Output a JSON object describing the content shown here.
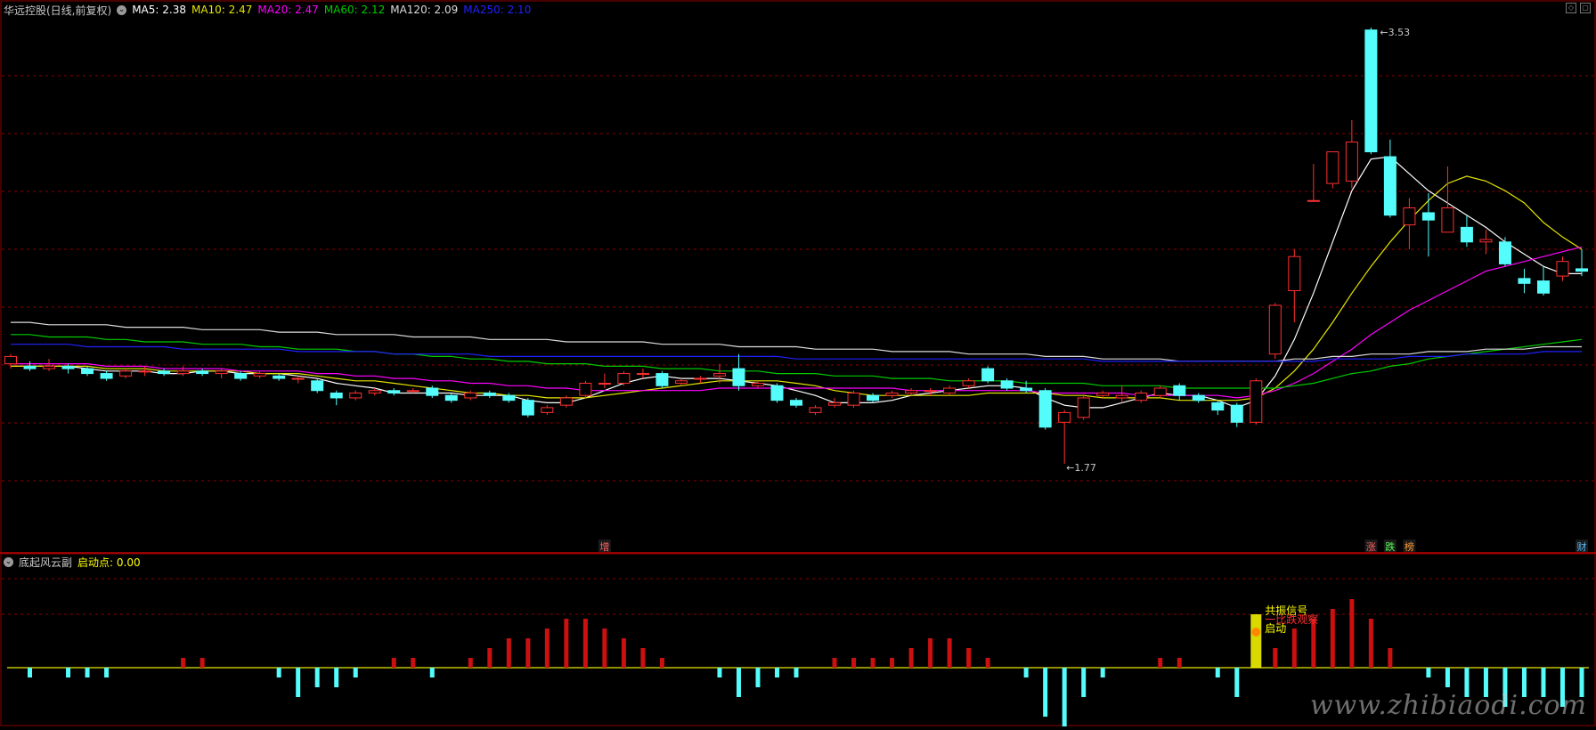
{
  "header": {
    "title": "华远控股(日线,前复权)",
    "ma": [
      {
        "label": "MA5: 2.38",
        "color": "#ffffff"
      },
      {
        "label": "MA10: 2.47",
        "color": "#e6e600"
      },
      {
        "label": "MA20: 2.47",
        "color": "#ff00ff"
      },
      {
        "label": "MA60: 2.12",
        "color": "#00cc00"
      },
      {
        "label": "MA120: 2.09",
        "color": "#dcdcdc"
      },
      {
        "label": "MA250: 2.10",
        "color": "#2020ff"
      }
    ]
  },
  "price_labels": {
    "high": "3.53",
    "low": "1.77"
  },
  "event_markers": [
    {
      "label": "增",
      "color": "#ff6060"
    },
    {
      "label": "涨",
      "color": "#ff6060"
    },
    {
      "label": "跌",
      "color": "#55ff55"
    },
    {
      "label": "榜",
      "color": "#ff9933"
    },
    {
      "label": "财",
      "color": "#55bbff"
    }
  ],
  "sub_panel": {
    "title": "底起风云副",
    "indicator_label": "启动点: 0.00",
    "signals": [
      {
        "label": "共振信号",
        "color": "#ffff00"
      },
      {
        "label": "一比跌观察",
        "color": "#ff3030"
      },
      {
        "label": "启动",
        "color": "#ffff00"
      }
    ]
  },
  "watermark": "www.zhibiaodi.com",
  "colors": {
    "up": "#ff3030",
    "down": "#54fcfc",
    "background": "#000000",
    "grid": "#8b0000"
  },
  "chart_data": {
    "type": "candlestick",
    "y_range": [
      1.7,
      3.6
    ],
    "candles": [
      [
        2.18,
        2.21,
        2.22,
        2.16
      ],
      [
        2.17,
        2.16,
        2.19,
        2.15
      ],
      [
        2.16,
        2.17,
        2.2,
        2.15
      ],
      [
        2.17,
        2.16,
        2.18,
        2.14
      ],
      [
        2.16,
        2.14,
        2.17,
        2.13
      ],
      [
        2.14,
        2.12,
        2.15,
        2.11
      ],
      [
        2.13,
        2.15,
        2.16,
        2.12
      ],
      [
        2.15,
        2.15,
        2.17,
        2.13
      ],
      [
        2.15,
        2.14,
        2.16,
        2.13
      ],
      [
        2.14,
        2.15,
        2.17,
        2.13
      ],
      [
        2.15,
        2.14,
        2.16,
        2.13
      ],
      [
        2.14,
        2.15,
        2.16,
        2.12
      ],
      [
        2.14,
        2.12,
        2.15,
        2.11
      ],
      [
        2.13,
        2.14,
        2.15,
        2.12
      ],
      [
        2.13,
        2.12,
        2.14,
        2.11
      ],
      [
        2.12,
        2.12,
        2.13,
        2.1
      ],
      [
        2.11,
        2.07,
        2.12,
        2.06
      ],
      [
        2.06,
        2.04,
        2.07,
        2.01
      ],
      [
        2.04,
        2.06,
        2.07,
        2.03
      ],
      [
        2.06,
        2.07,
        2.08,
        2.05
      ],
      [
        2.07,
        2.06,
        2.08,
        2.05
      ],
      [
        2.07,
        2.07,
        2.08,
        2.06
      ],
      [
        2.08,
        2.05,
        2.09,
        2.04
      ],
      [
        2.05,
        2.03,
        2.06,
        2.02
      ],
      [
        2.04,
        2.06,
        2.07,
        2.03
      ],
      [
        2.06,
        2.05,
        2.07,
        2.04
      ],
      [
        2.05,
        2.03,
        2.06,
        2.02
      ],
      [
        2.03,
        1.97,
        2.04,
        1.96
      ],
      [
        1.98,
        2.0,
        2.01,
        1.97
      ],
      [
        2.01,
        2.04,
        2.05,
        2.0
      ],
      [
        2.05,
        2.1,
        2.11,
        2.04
      ],
      [
        2.1,
        2.1,
        2.14,
        2.08
      ],
      [
        2.1,
        2.14,
        2.15,
        2.09
      ],
      [
        2.14,
        2.14,
        2.16,
        2.12
      ],
      [
        2.14,
        2.09,
        2.15,
        2.08
      ],
      [
        2.1,
        2.11,
        2.12,
        2.09
      ],
      [
        2.12,
        2.12,
        2.13,
        2.1
      ],
      [
        2.13,
        2.14,
        2.18,
        2.1
      ],
      [
        2.16,
        2.09,
        2.22,
        2.07
      ],
      [
        2.09,
        2.1,
        2.11,
        2.08
      ],
      [
        2.09,
        2.03,
        2.1,
        2.02
      ],
      [
        2.03,
        2.01,
        2.04,
        2.0
      ],
      [
        1.98,
        2.0,
        2.01,
        1.97
      ],
      [
        2.01,
        2.02,
        2.04,
        2.0
      ],
      [
        2.01,
        2.06,
        2.07,
        2.0
      ],
      [
        2.05,
        2.03,
        2.06,
        2.02
      ],
      [
        2.05,
        2.06,
        2.07,
        2.04
      ],
      [
        2.06,
        2.07,
        2.08,
        2.05
      ],
      [
        2.07,
        2.07,
        2.08,
        2.05
      ],
      [
        2.06,
        2.08,
        2.09,
        2.05
      ],
      [
        2.09,
        2.11,
        2.12,
        2.08
      ],
      [
        2.16,
        2.11,
        2.17,
        2.1
      ],
      [
        2.11,
        2.08,
        2.12,
        2.07
      ],
      [
        2.08,
        2.07,
        2.11,
        2.06
      ],
      [
        2.07,
        1.92,
        2.08,
        1.91
      ],
      [
        1.94,
        1.98,
        1.99,
        1.77
      ],
      [
        1.96,
        2.04,
        2.05,
        1.95
      ],
      [
        2.05,
        2.06,
        2.07,
        2.04
      ],
      [
        2.04,
        2.05,
        2.09,
        2.02
      ],
      [
        2.03,
        2.06,
        2.07,
        2.02
      ],
      [
        2.05,
        2.08,
        2.09,
        2.04
      ],
      [
        2.09,
        2.05,
        2.1,
        2.03
      ],
      [
        2.05,
        2.03,
        2.06,
        2.02
      ],
      [
        2.02,
        1.99,
        2.03,
        1.97
      ],
      [
        2.01,
        1.94,
        2.02,
        1.92
      ],
      [
        1.94,
        2.11,
        2.12,
        1.93
      ],
      [
        2.22,
        2.42,
        2.43,
        2.2
      ],
      [
        2.48,
        2.62,
        2.65,
        2.35
      ],
      [
        2.85,
        2.85,
        3.0,
        2.85
      ],
      [
        2.92,
        3.05,
        3.05,
        2.9
      ],
      [
        2.93,
        3.09,
        3.18,
        2.9
      ],
      [
        3.55,
        3.05,
        3.56,
        3.04
      ],
      [
        3.03,
        2.79,
        3.1,
        2.78
      ],
      [
        2.75,
        2.82,
        2.86,
        2.65
      ],
      [
        2.8,
        2.77,
        2.88,
        2.62
      ],
      [
        2.72,
        2.82,
        2.99,
        2.72
      ],
      [
        2.74,
        2.68,
        2.79,
        2.66
      ],
      [
        2.68,
        2.69,
        2.73,
        2.63
      ],
      [
        2.68,
        2.59,
        2.7,
        2.58
      ],
      [
        2.53,
        2.51,
        2.57,
        2.47
      ],
      [
        2.52,
        2.47,
        2.58,
        2.46
      ],
      [
        2.54,
        2.6,
        2.62,
        2.52
      ],
      [
        2.57,
        2.56,
        2.65,
        2.54
      ]
    ],
    "ma_lines": {
      "MA5": [
        2.17,
        2.17,
        2.17,
        2.17,
        2.16,
        2.15,
        2.15,
        2.15,
        2.14,
        2.14,
        2.15,
        2.15,
        2.14,
        2.14,
        2.14,
        2.13,
        2.12,
        2.1,
        2.09,
        2.08,
        2.06,
        2.06,
        2.06,
        2.06,
        2.05,
        2.05,
        2.05,
        2.03,
        2.02,
        2.02,
        2.04,
        2.07,
        2.1,
        2.12,
        2.13,
        2.12,
        2.12,
        2.12,
        2.11,
        2.1,
        2.09,
        2.07,
        2.05,
        2.02,
        2.02,
        2.02,
        2.03,
        2.05,
        2.06,
        2.07,
        2.08,
        2.09,
        2.09,
        2.08,
        2.04,
        2.01,
        2.0,
        2.0,
        2.02,
        2.04,
        2.06,
        2.05,
        2.05,
        2.03,
        2.0,
        2.03,
        2.13,
        2.28,
        2.47,
        2.68,
        2.89,
        3.02,
        3.03,
        2.96,
        2.89,
        2.84,
        2.79,
        2.74,
        2.68,
        2.63,
        2.58,
        2.55,
        2.55
      ],
      "MA10": [
        2.17,
        2.17,
        2.17,
        2.17,
        2.17,
        2.16,
        2.16,
        2.16,
        2.15,
        2.15,
        2.15,
        2.15,
        2.15,
        2.14,
        2.14,
        2.14,
        2.13,
        2.12,
        2.11,
        2.11,
        2.1,
        2.09,
        2.08,
        2.07,
        2.06,
        2.06,
        2.05,
        2.05,
        2.04,
        2.04,
        2.04,
        2.05,
        2.06,
        2.07,
        2.08,
        2.09,
        2.1,
        2.11,
        2.11,
        2.11,
        2.11,
        2.1,
        2.09,
        2.07,
        2.06,
        2.05,
        2.05,
        2.05,
        2.05,
        2.05,
        2.05,
        2.06,
        2.06,
        2.06,
        2.06,
        2.05,
        2.05,
        2.04,
        2.04,
        2.04,
        2.04,
        2.03,
        2.03,
        2.03,
        2.03,
        2.04,
        2.08,
        2.15,
        2.24,
        2.35,
        2.47,
        2.58,
        2.68,
        2.77,
        2.85,
        2.92,
        2.95,
        2.93,
        2.89,
        2.84,
        2.76,
        2.7,
        2.65
      ],
      "MA20": [
        2.18,
        2.18,
        2.18,
        2.18,
        2.18,
        2.17,
        2.17,
        2.17,
        2.16,
        2.16,
        2.16,
        2.16,
        2.15,
        2.15,
        2.15,
        2.15,
        2.14,
        2.14,
        2.13,
        2.13,
        2.12,
        2.12,
        2.11,
        2.11,
        2.1,
        2.1,
        2.09,
        2.09,
        2.08,
        2.08,
        2.07,
        2.07,
        2.07,
        2.07,
        2.07,
        2.07,
        2.07,
        2.08,
        2.08,
        2.08,
        2.08,
        2.08,
        2.08,
        2.08,
        2.08,
        2.08,
        2.08,
        2.07,
        2.07,
        2.07,
        2.07,
        2.07,
        2.07,
        2.07,
        2.06,
        2.06,
        2.06,
        2.06,
        2.06,
        2.05,
        2.05,
        2.05,
        2.05,
        2.05,
        2.04,
        2.05,
        2.07,
        2.1,
        2.14,
        2.19,
        2.24,
        2.3,
        2.35,
        2.4,
        2.44,
        2.48,
        2.52,
        2.56,
        2.58,
        2.6,
        2.62,
        2.64,
        2.66
      ],
      "MA60": [
        2.3,
        2.3,
        2.29,
        2.29,
        2.29,
        2.28,
        2.28,
        2.27,
        2.27,
        2.27,
        2.26,
        2.26,
        2.26,
        2.25,
        2.25,
        2.24,
        2.24,
        2.24,
        2.23,
        2.23,
        2.22,
        2.22,
        2.21,
        2.21,
        2.2,
        2.2,
        2.19,
        2.19,
        2.18,
        2.18,
        2.18,
        2.17,
        2.17,
        2.17,
        2.16,
        2.16,
        2.16,
        2.15,
        2.15,
        2.15,
        2.14,
        2.14,
        2.14,
        2.13,
        2.13,
        2.13,
        2.12,
        2.12,
        2.12,
        2.11,
        2.11,
        2.11,
        2.11,
        2.1,
        2.1,
        2.1,
        2.1,
        2.09,
        2.09,
        2.09,
        2.09,
        2.08,
        2.08,
        2.08,
        2.08,
        2.08,
        2.08,
        2.09,
        2.1,
        2.12,
        2.14,
        2.15,
        2.17,
        2.18,
        2.2,
        2.21,
        2.22,
        2.23,
        2.24,
        2.25,
        2.26,
        2.27,
        2.28
      ],
      "MA120": [
        2.35,
        2.35,
        2.34,
        2.34,
        2.34,
        2.34,
        2.33,
        2.33,
        2.33,
        2.33,
        2.32,
        2.32,
        2.32,
        2.32,
        2.31,
        2.31,
        2.31,
        2.3,
        2.3,
        2.3,
        2.3,
        2.29,
        2.29,
        2.29,
        2.29,
        2.28,
        2.28,
        2.28,
        2.28,
        2.27,
        2.27,
        2.27,
        2.27,
        2.27,
        2.26,
        2.26,
        2.26,
        2.26,
        2.25,
        2.25,
        2.25,
        2.25,
        2.24,
        2.24,
        2.24,
        2.24,
        2.23,
        2.23,
        2.23,
        2.23,
        2.22,
        2.22,
        2.22,
        2.22,
        2.21,
        2.21,
        2.21,
        2.2,
        2.2,
        2.2,
        2.2,
        2.19,
        2.19,
        2.19,
        2.19,
        2.19,
        2.19,
        2.2,
        2.2,
        2.21,
        2.21,
        2.22,
        2.22,
        2.22,
        2.23,
        2.23,
        2.23,
        2.24,
        2.24,
        2.24,
        2.25,
        2.25,
        2.25
      ],
      "MA250": [
        2.26,
        2.26,
        2.26,
        2.26,
        2.25,
        2.25,
        2.25,
        2.25,
        2.25,
        2.24,
        2.24,
        2.24,
        2.24,
        2.24,
        2.24,
        2.23,
        2.23,
        2.23,
        2.23,
        2.23,
        2.22,
        2.22,
        2.22,
        2.22,
        2.22,
        2.21,
        2.21,
        2.21,
        2.21,
        2.21,
        2.21,
        2.21,
        2.21,
        2.21,
        2.21,
        2.21,
        2.21,
        2.21,
        2.21,
        2.21,
        2.21,
        2.2,
        2.2,
        2.2,
        2.2,
        2.2,
        2.2,
        2.2,
        2.2,
        2.2,
        2.2,
        2.2,
        2.2,
        2.2,
        2.2,
        2.2,
        2.2,
        2.19,
        2.19,
        2.19,
        2.19,
        2.19,
        2.19,
        2.19,
        2.19,
        2.19,
        2.19,
        2.19,
        2.19,
        2.2,
        2.2,
        2.2,
        2.2,
        2.21,
        2.21,
        2.21,
        2.22,
        2.22,
        2.22,
        2.22,
        2.23,
        2.23,
        2.23
      ]
    },
    "sub_histogram": [
      0,
      -1,
      0,
      -1,
      -1,
      -1,
      0,
      0,
      0,
      1,
      1,
      0,
      0,
      0,
      -1,
      -3,
      -2,
      -2,
      -1,
      0,
      1,
      1,
      -1,
      0,
      1,
      2,
      3,
      3,
      4,
      5,
      5,
      4,
      3,
      2,
      1,
      0,
      0,
      -1,
      -3,
      -2,
      -1,
      -1,
      0,
      1,
      1,
      1,
      1,
      2,
      3,
      3,
      2,
      1,
      0,
      -1,
      -5,
      -6,
      -3,
      -1,
      0,
      0,
      1,
      1,
      0,
      -1,
      -3,
      0,
      2,
      4,
      5,
      6,
      7,
      5,
      2,
      0,
      -1,
      -2,
      -3,
      -3,
      -4,
      -3,
      -3,
      -4,
      -3
    ]
  }
}
